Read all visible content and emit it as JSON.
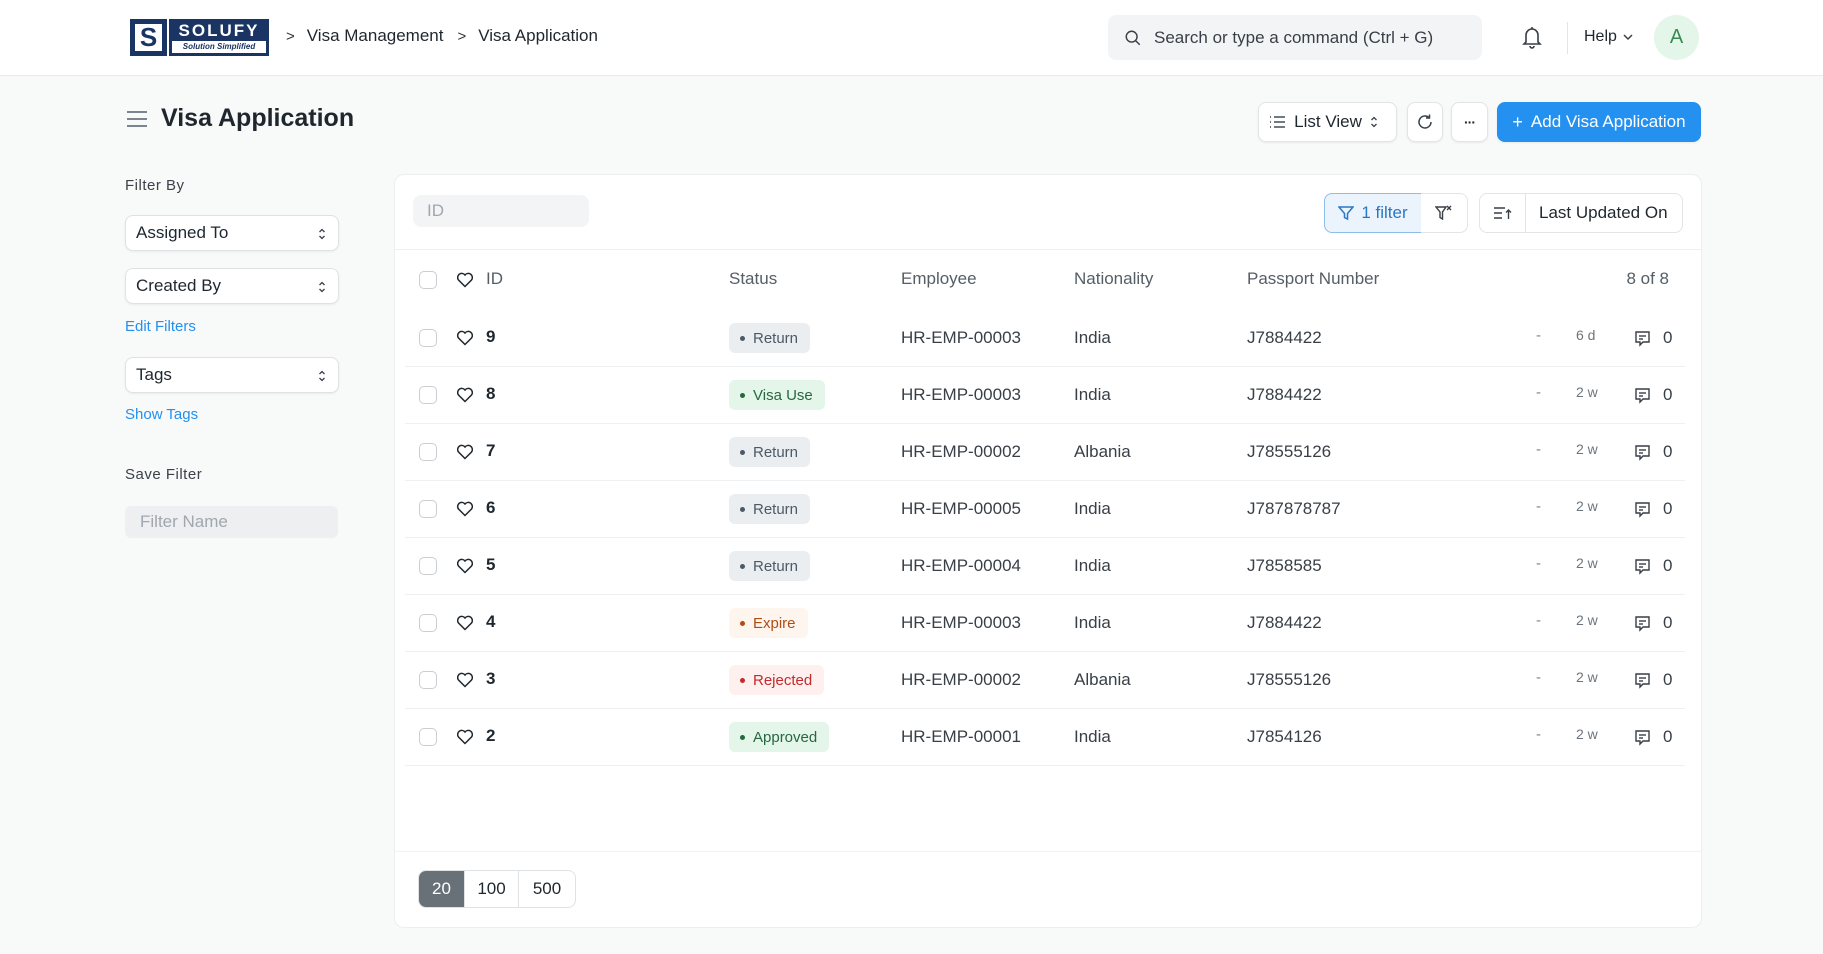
{
  "navbar": {
    "logo": {
      "title": "SOLUFY",
      "subtitle": "Solution Simplified",
      "mark": "S"
    },
    "breadcrumbs": [
      "Visa Management",
      "Visa Application"
    ],
    "search_placeholder": "Search or type a command (Ctrl + G)",
    "help_label": "Help",
    "avatar_initial": "A"
  },
  "page": {
    "title": "Visa Application",
    "toolbar": {
      "view_label": "List View",
      "add_label": "Add Visa Application",
      "add_icon": "+",
      "more_label": "···"
    }
  },
  "sidebar": {
    "filter_by_label": "Filter By",
    "assigned_to": "Assigned To",
    "created_by": "Created By",
    "edit_filters": "Edit Filters",
    "tags": "Tags",
    "show_tags": "Show Tags",
    "save_filter_label": "Save Filter",
    "filter_name_placeholder": "Filter Name"
  },
  "list": {
    "id_filter_placeholder": "ID",
    "filter_button": "1 filter",
    "sort_field": "Last Updated On",
    "columns": [
      "ID",
      "Status",
      "Employee",
      "Nationality",
      "Passport Number"
    ],
    "count_label": "8 of 8",
    "rows": [
      {
        "id": "9",
        "status": "Return",
        "status_color": "gray",
        "employee": "HR-EMP-00003",
        "nationality": "India",
        "passport": "J7884422",
        "assigned": "-",
        "modified": "6 d",
        "comments": "0"
      },
      {
        "id": "8",
        "status": "Visa Use",
        "status_color": "green",
        "employee": "HR-EMP-00003",
        "nationality": "India",
        "passport": "J7884422",
        "assigned": "-",
        "modified": "2 w",
        "comments": "0"
      },
      {
        "id": "7",
        "status": "Return",
        "status_color": "gray",
        "employee": "HR-EMP-00002",
        "nationality": "Albania",
        "passport": "J78555126",
        "assigned": "-",
        "modified": "2 w",
        "comments": "0"
      },
      {
        "id": "6",
        "status": "Return",
        "status_color": "gray",
        "employee": "HR-EMP-00005",
        "nationality": "India",
        "passport": "J787878787",
        "assigned": "-",
        "modified": "2 w",
        "comments": "0"
      },
      {
        "id": "5",
        "status": "Return",
        "status_color": "gray",
        "employee": "HR-EMP-00004",
        "nationality": "India",
        "passport": "J7858585",
        "assigned": "-",
        "modified": "2 w",
        "comments": "0"
      },
      {
        "id": "4",
        "status": "Expire",
        "status_color": "orange",
        "employee": "HR-EMP-00003",
        "nationality": "India",
        "passport": "J7884422",
        "assigned": "-",
        "modified": "2 w",
        "comments": "0"
      },
      {
        "id": "3",
        "status": "Rejected",
        "status_color": "red",
        "employee": "HR-EMP-00002",
        "nationality": "Albania",
        "passport": "J78555126",
        "assigned": "-",
        "modified": "2 w",
        "comments": "0"
      },
      {
        "id": "2",
        "status": "Approved",
        "status_color": "green",
        "employee": "HR-EMP-00001",
        "nationality": "India",
        "passport": "J7854126",
        "assigned": "-",
        "modified": "2 w",
        "comments": "0"
      }
    ],
    "page_sizes": [
      "20",
      "100",
      "500"
    ],
    "active_page_size": "20"
  },
  "icons": {
    "search": "search-icon",
    "bell": "bell-icon",
    "menu": "hamburger-icon",
    "list": "list-icon",
    "refresh": "refresh-icon",
    "filter": "filter-icon",
    "clear_filter": "filter-x-icon",
    "sort": "sort-ascending-icon",
    "heart": "heart-icon",
    "comment": "comment-icon"
  },
  "colors": {
    "primary": "#2490ef",
    "brand_navy": "#1a3463",
    "status_gray": "#4c5a67",
    "status_green": "#27683f",
    "status_orange": "#b04d13",
    "status_red": "#c52929"
  }
}
